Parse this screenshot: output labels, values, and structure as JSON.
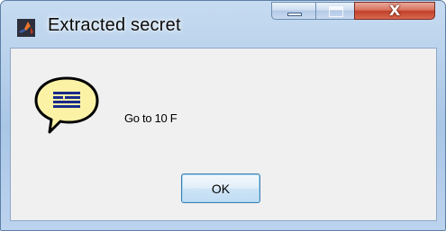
{
  "window": {
    "title": "Extracted secret",
    "app_icon": "matlab-logo-icon",
    "controls": {
      "minimize_icon": "minimize-icon",
      "maximize_icon": "maximize-icon",
      "close_icon": "close-icon",
      "close_glyph": "X"
    }
  },
  "dialog": {
    "icon": "help-speech-bubble-icon",
    "message": "Go to 10 F",
    "ok_label": "OK"
  },
  "colors": {
    "close_red": "#c2412a",
    "bubble_fill": "#fbf2a6",
    "bubble_lines": "#1a2a8c"
  }
}
